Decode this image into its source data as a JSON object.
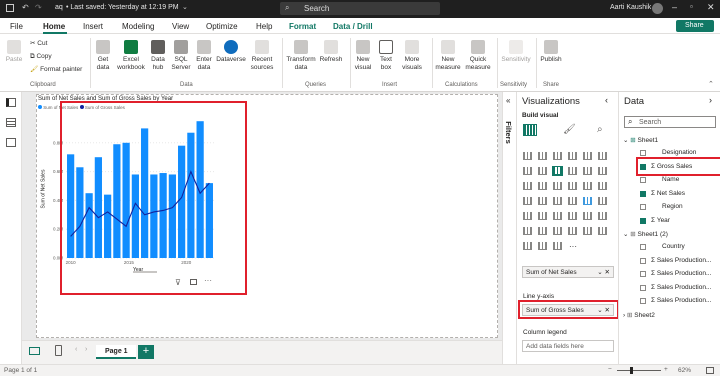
{
  "titlebar": {
    "app": "aq",
    "saved": "• Last saved: Yesterday at 12:19 PM",
    "search": "Search",
    "user": "Aarti Kaushik"
  },
  "menu": [
    "File",
    "Home",
    "Insert",
    "Modeling",
    "View",
    "Optimize",
    "Help",
    "Format",
    "Data / Drill"
  ],
  "share": "Share",
  "ribbon": {
    "clipboard": {
      "paste": "Paste",
      "cut": "Cut",
      "copy": "Copy",
      "format_painter": "Format painter",
      "group": "Clipboard"
    },
    "data_buttons": [
      "Get data",
      "Excel workbook",
      "Data hub",
      "SQL Server",
      "Enter data",
      "Dataverse",
      "Recent sources"
    ],
    "data_group": "Data",
    "queries": [
      "Transform data",
      "Refresh"
    ],
    "queries_group": "Queries",
    "insert": [
      "New visual",
      "Text box",
      "More visuals"
    ],
    "insert_group": "Insert",
    "calc": [
      "New measure",
      "Quick measure"
    ],
    "calc_group": "Calculations",
    "sensitivity": "Sensitivity",
    "sensitivity_group": "Sensitivity",
    "publish": "Publish",
    "share_group": "Share"
  },
  "chart_data": {
    "type": "bar",
    "title": "Sum of Net Sales and Sum of Gross Sales by Year",
    "legend": [
      "Sum of Net Sales",
      "Sum of Gross Sales"
    ],
    "xlabel": "Year",
    "ylabel": "Sum of Net Sales",
    "x_ticks": [
      "2010",
      "2015",
      "2020"
    ],
    "y_ticks": [
      "0.0M",
      "0.2M",
      "0.4M",
      "0.6M",
      "0.8M"
    ],
    "ylim": [
      0,
      1.0
    ],
    "bars": [
      0.72,
      0.63,
      0.45,
      0.7,
      0.44,
      0.79,
      0.8,
      0.58,
      0.9,
      0.58,
      0.59,
      0.58,
      0.78,
      0.87,
      0.95,
      0.52
    ],
    "line": [
      0.15,
      0.22,
      0.35,
      0.28,
      0.32,
      0.27,
      0.22,
      0.38,
      0.3,
      0.32,
      0.33,
      0.35,
      0.42,
      0.6,
      0.45,
      0.52
    ],
    "colors": {
      "bar": "#118dff",
      "line": "#12239e"
    }
  },
  "pages": {
    "active": "Page 1",
    "status": "Page 1 of 1",
    "zoom": "62%"
  },
  "filters_label": "Filters",
  "viz": {
    "title": "Visualizations",
    "build": "Build visual",
    "wells": [
      {
        "label": "",
        "value": "Sum of Net Sales"
      },
      {
        "label": "Line y-axis",
        "value": "Sum of Gross Sales"
      },
      {
        "label": "Column legend",
        "value": "Add data fields here"
      }
    ]
  },
  "data": {
    "title": "Data",
    "search": "Search",
    "tables": [
      {
        "name": "Sheet1",
        "fields": [
          {
            "name": "Designation",
            "checked": false
          },
          {
            "name": "Gross Sales",
            "checked": true,
            "sigma": true
          },
          {
            "name": "Name",
            "checked": false
          },
          {
            "name": "Net Sales",
            "checked": true,
            "sigma": true
          },
          {
            "name": "Region",
            "checked": false
          },
          {
            "name": "Year",
            "checked": true,
            "sigma": true
          }
        ]
      },
      {
        "name": "Sheet1 (2)",
        "fields": [
          {
            "name": "Country",
            "checked": false
          },
          {
            "name": "Sales Production...",
            "checked": false,
            "sigma": true
          },
          {
            "name": "Sales Production...",
            "checked": false,
            "sigma": true
          },
          {
            "name": "Sales Production...",
            "checked": false,
            "sigma": true
          },
          {
            "name": "Sales Production...",
            "checked": false,
            "sigma": true
          }
        ]
      },
      {
        "name": "Sheet2",
        "fields": []
      }
    ]
  }
}
